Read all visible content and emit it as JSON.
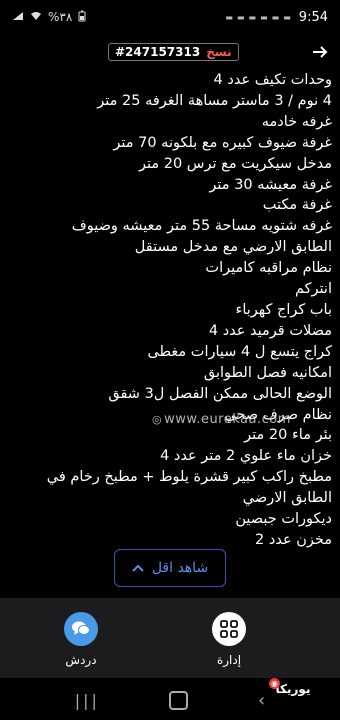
{
  "status_bar": {
    "time": "9:54",
    "battery": "%٣٨",
    "notification_icons": [
      "notification-icon",
      "notification-icon",
      "notification-icon",
      "notification-icon",
      "notification-icon",
      "notification-icon"
    ]
  },
  "header": {
    "copy_label": "نسخ",
    "listing_id": "#247157313"
  },
  "description_lines": [
    "وحدات تكيف عدد 4",
    "4 نوم / 3 ماستر مساهة الغرفه 25 متر",
    "غرفه خادمه",
    "غرفة ضيوف كبيره مع بلكونه 70 متر",
    "مدخل سيكريت مع ترس 20 متر",
    "غرفة معيشه 30 متر",
    "غرفة مكتب",
    "غرفه شتويه مساحة 55 متر معيشه وضيوف",
    "الطابق الارضي مع مدخل مستقل",
    "نظام مراقبه كاميرات",
    "انتركم",
    "باب كراج كهرباء",
    "مضلات قرميد عدد 4",
    "كراج يتسع ل 4 سيارات مغطى",
    "امكانيه فصل الطوابق",
    "الوضع الحالى ممكن الفصل ل3 شقق",
    "نظام صرف صحي",
    "بئر ماء 20 متر",
    "خزان ماء علوي 2 متر عدد 4",
    "مطبخ راكب كبير قشرة يلوط + مطبخ رخام في",
    "الطابق الارضي",
    "ديكورات جبصين",
    "مخزن عدد 2"
  ],
  "watermark": "www.eurekaa.com",
  "show_less": {
    "label": "شاهد اقل"
  },
  "bottom_tabs": {
    "chat_label": "دردش",
    "admin_label": "إدارة"
  },
  "app_logo": "يوريكا"
}
